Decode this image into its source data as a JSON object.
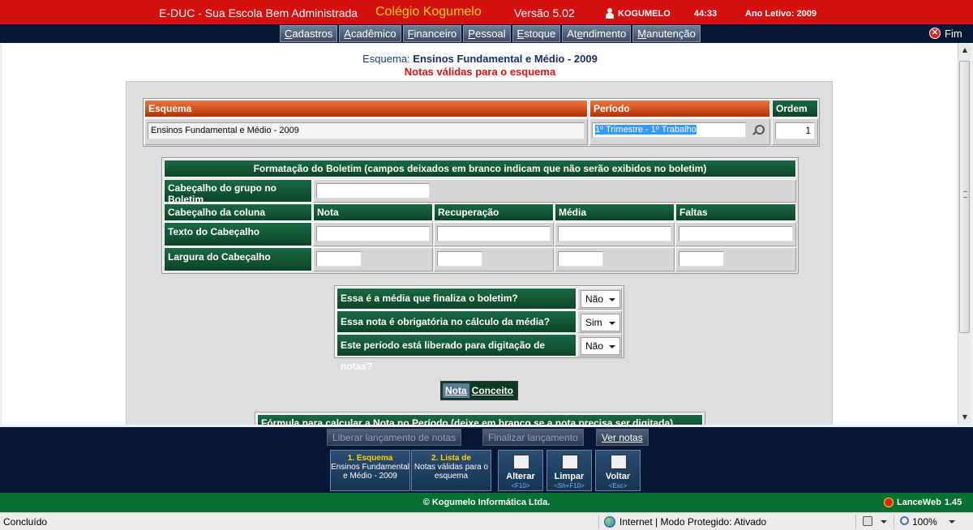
{
  "topbar": {
    "app_name": "E-DUC - Sua Escola Bem Administrada",
    "school": "Colégio Kogumelo",
    "version": "Versão 5.02",
    "user": "KOGUMELO",
    "time": "44:33",
    "year": "Ano Letivo: 2009"
  },
  "menu": {
    "items": [
      "Cadastros",
      "Acadêmico",
      "Financeiro",
      "Pessoal",
      "Estoque",
      "Atendimento",
      "Manutenção"
    ],
    "underline": [
      "C",
      "A",
      "F",
      "P",
      "E",
      "e",
      "M"
    ],
    "logout": "Fim"
  },
  "page": {
    "heading_label": "Esquema:",
    "heading_value": "Ensinos Fundamental e Médio - 2009",
    "subheading": "Notas válidas para o esquema"
  },
  "form": {
    "esquema_label": "Esquema",
    "periodo_label": "Período",
    "ordem_label": "Ordem",
    "esquema_value": "Ensinos Fundamental e Médio - 2009",
    "periodo_value": "1º Trimestre - 1º Trabalho",
    "ordem_value": "1"
  },
  "boletim": {
    "title": "Formatação do Boletim (campos deixados em branco indicam que não serão exibidos no boletim)",
    "grupo_label": "Cabeçalho do grupo no Boletim",
    "coluna_label": "Cabeçalho da coluna",
    "columns": [
      "Nota",
      "Recuperação",
      "Média",
      "Faltas"
    ],
    "texto_label": "Texto do Cabeçalho",
    "largura_label": "Largura do Cabeçalho"
  },
  "questions": [
    {
      "label": "Essa é a média que finaliza o boletim?",
      "value": "Não"
    },
    {
      "label": "Essa nota é obrigatória no cálculo da média?",
      "value": "Sim"
    },
    {
      "label": "Este período está liberado para digitação de notas?",
      "value": "Não"
    }
  ],
  "toggle": {
    "nota": "Nota",
    "conceito": "Conceito"
  },
  "formula_label": "Fórmula para calcular a Nota no Período (deixe em branco se a nota precisa ser digitada)",
  "actions": {
    "liberar": "Liberar lançamento de notas",
    "finalizar": "Finalizar lançamento",
    "ver_notas": "Ver notas"
  },
  "tabs": [
    {
      "title": "1. Esquema",
      "text": "Ensinos Fundamental e Médio - 2009"
    },
    {
      "title": "2. Lista de",
      "text": "Notas válidas para o esquema"
    }
  ],
  "buttons": [
    {
      "label": "Alterar",
      "key": "<F10>",
      "icon": "edit-icon"
    },
    {
      "label": "Limpar",
      "key": "<Sh+F10>",
      "icon": "clear-icon"
    },
    {
      "label": "Voltar",
      "key": "<Esc>",
      "icon": "back-icon"
    }
  ],
  "footer": {
    "copyright": "© Kogumelo Informática Ltda.",
    "brand": "LanceWeb",
    "version": "1.45"
  },
  "status": {
    "left": "Concluído",
    "zone": "Internet | Modo Protegido: Ativado",
    "zoom": "100%"
  },
  "colors": {
    "top_red": "#d40f10",
    "navy": "#061736",
    "green": "#087032",
    "orange": "#c8400e"
  }
}
